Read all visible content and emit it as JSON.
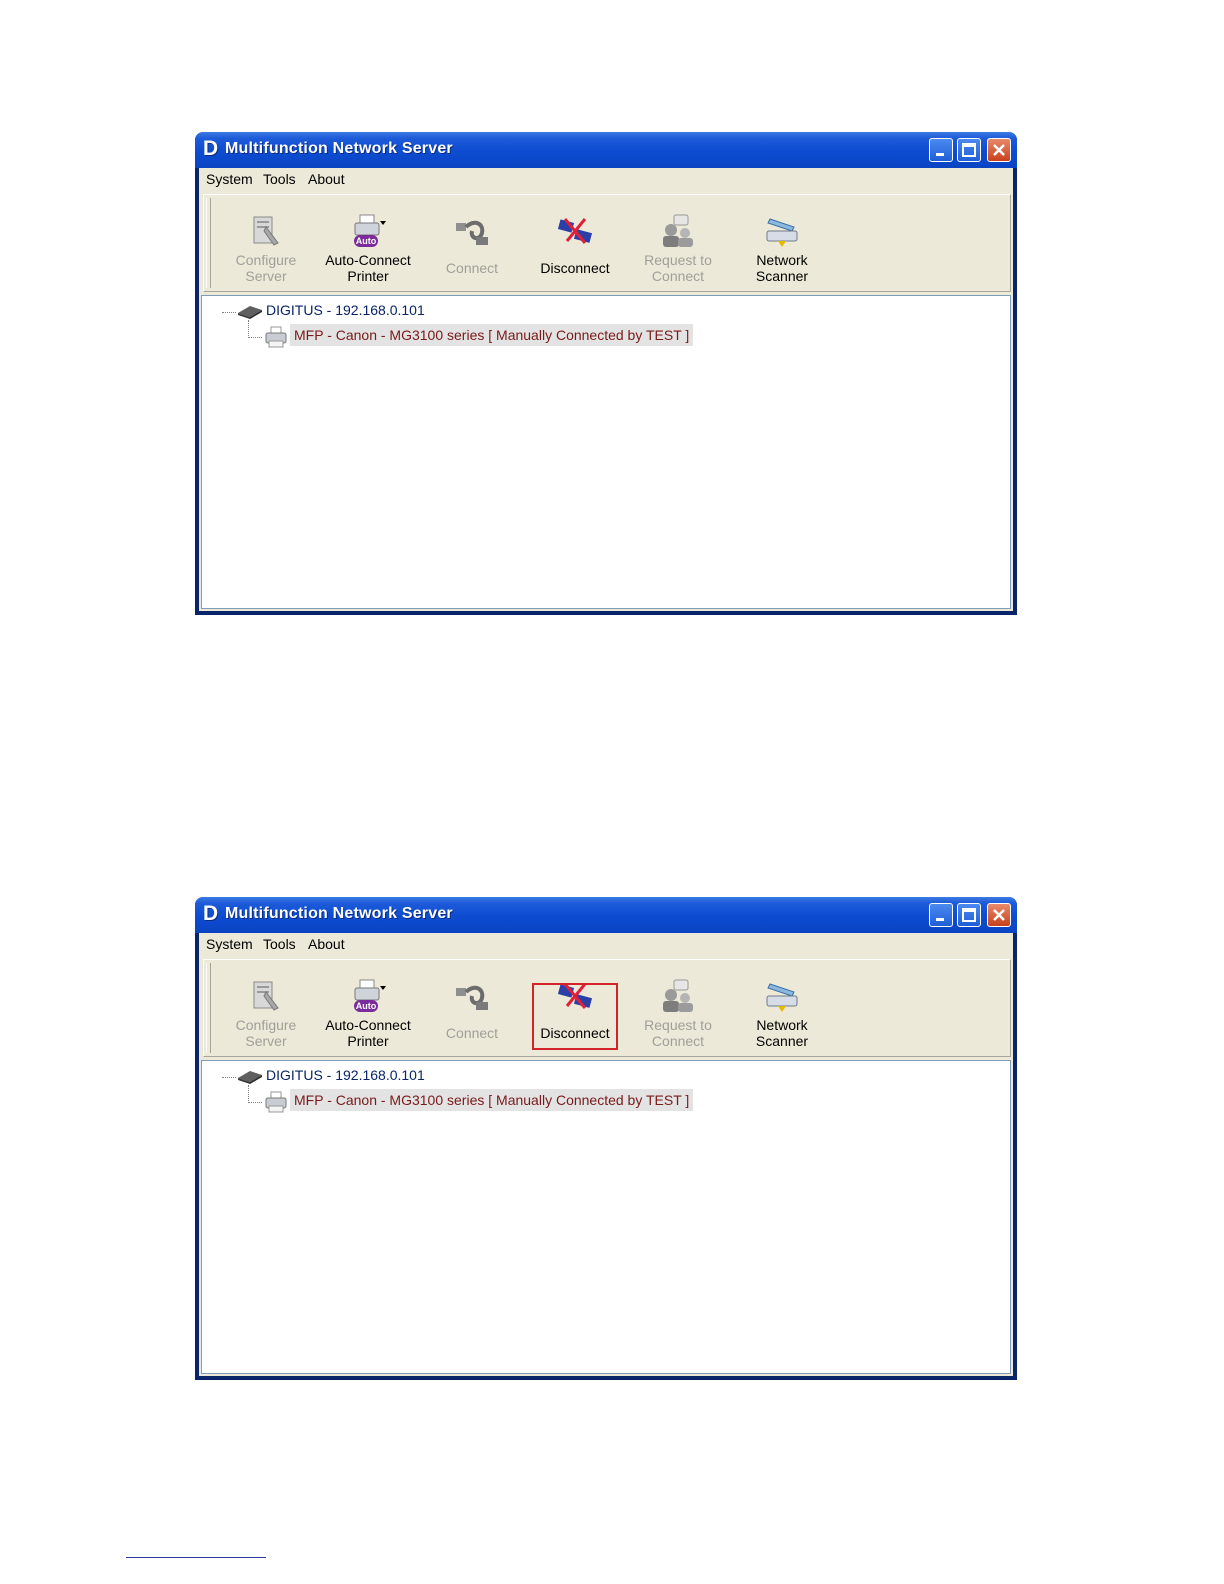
{
  "windows": [
    {
      "title": "Multifunction Network Server",
      "logo_letter": "D",
      "menu": [
        "System",
        "Tools",
        "About"
      ],
      "toolbar": [
        {
          "label_line1": "Configure",
          "label_line2": "Server",
          "enabled": false,
          "icon": "configure-server-icon"
        },
        {
          "label_line1": "Auto-Connect",
          "label_line2": "Printer",
          "enabled": true,
          "icon": "auto-connect-printer-icon",
          "badge": "Auto"
        },
        {
          "label_line1": "Connect",
          "label_line2": "",
          "enabled": false,
          "icon": "connect-icon"
        },
        {
          "label_line1": "Disconnect",
          "label_line2": "",
          "enabled": true,
          "icon": "disconnect-icon"
        },
        {
          "label_line1": "Request to",
          "label_line2": "Connect",
          "enabled": false,
          "icon": "request-to-connect-icon"
        },
        {
          "label_line1": "Network",
          "label_line2": "Scanner",
          "enabled": true,
          "icon": "network-scanner-icon"
        }
      ],
      "tree": {
        "server": "DIGITUS - 192.168.0.101",
        "printer": "MFP - Canon - MG3100 series [ Manually Connected by TEST ]"
      },
      "highlight": ""
    },
    {
      "title": "Multifunction Network Server",
      "logo_letter": "D",
      "menu": [
        "System",
        "Tools",
        "About"
      ],
      "toolbar": [
        {
          "label_line1": "Configure",
          "label_line2": "Server",
          "enabled": false,
          "icon": "configure-server-icon"
        },
        {
          "label_line1": "Auto-Connect",
          "label_line2": "Printer",
          "enabled": true,
          "icon": "auto-connect-printer-icon",
          "badge": "Auto"
        },
        {
          "label_line1": "Connect",
          "label_line2": "",
          "enabled": false,
          "icon": "connect-icon"
        },
        {
          "label_line1": "Disconnect",
          "label_line2": "",
          "enabled": true,
          "icon": "disconnect-icon"
        },
        {
          "label_line1": "Request to",
          "label_line2": "Connect",
          "enabled": false,
          "icon": "request-to-connect-icon"
        },
        {
          "label_line1": "Network",
          "label_line2": "Scanner",
          "enabled": true,
          "icon": "network-scanner-icon"
        }
      ],
      "tree": {
        "server": "DIGITUS - 192.168.0.101",
        "printer": "MFP - Canon - MG3100 series [ Manually Connected by TEST ]"
      },
      "highlight": "Disconnect",
      "highlight_color": "#d2232a"
    }
  ]
}
